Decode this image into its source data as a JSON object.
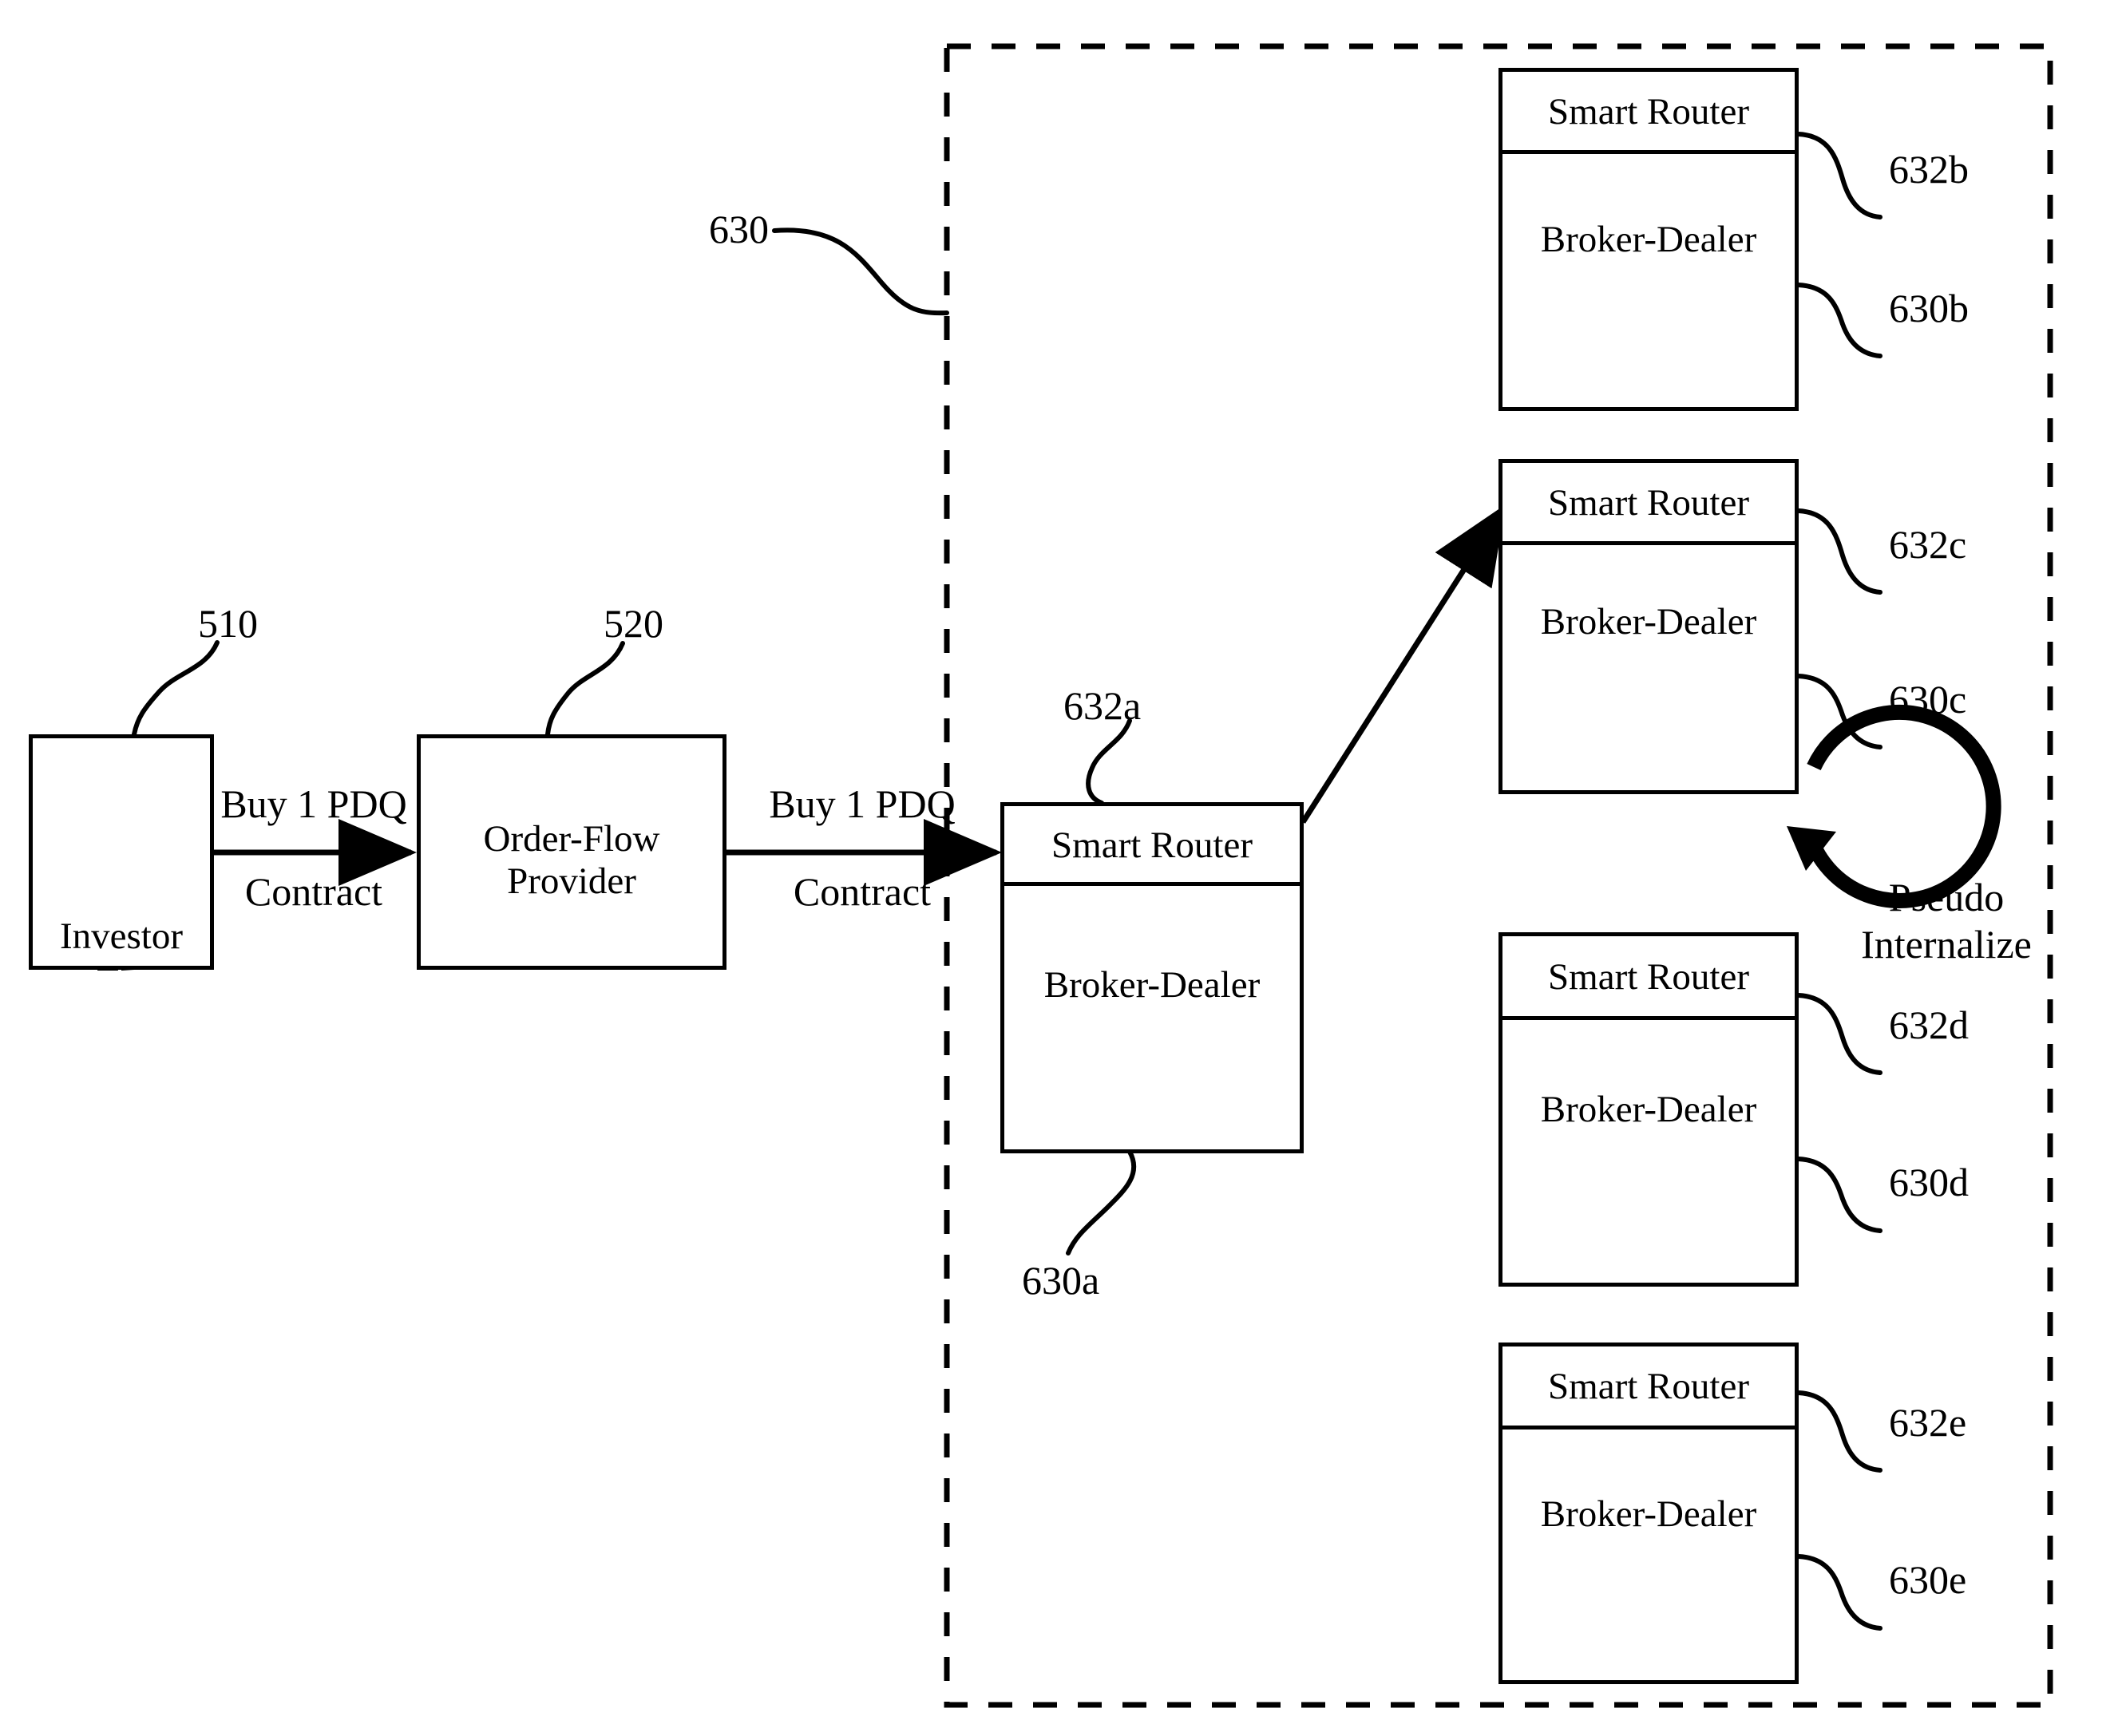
{
  "figure": {
    "type": "patent-flow-diagram",
    "dashed_group_label": "630"
  },
  "entities": {
    "investor": {
      "label": "Investor",
      "ref": "510",
      "icon": "investor-silhouette-icon"
    },
    "order_flow_provider": {
      "label_line1": "Order-Flow",
      "label_line2": "Provider",
      "ref": "520"
    }
  },
  "flows": [
    {
      "id": "investor-to-ofp",
      "label_above": "Buy 1 PDQ",
      "label_below": "Contract"
    },
    {
      "id": "ofp-to-bd-a",
      "label_above": "Buy 1 PDQ",
      "label_below": "Contract"
    }
  ],
  "broker_dealers": [
    {
      "id": "a",
      "router_label": "Smart Router",
      "dealer_label": "Broker-Dealer",
      "router_ref": "632a",
      "dealer_ref": "630a"
    },
    {
      "id": "b",
      "router_label": "Smart Router",
      "dealer_label": "Broker-Dealer",
      "router_ref": "632b",
      "dealer_ref": "630b"
    },
    {
      "id": "c",
      "router_label": "Smart Router",
      "dealer_label": "Broker-Dealer",
      "router_ref": "632c",
      "dealer_ref": "630c"
    },
    {
      "id": "d",
      "router_label": "Smart Router",
      "dealer_label": "Broker-Dealer",
      "router_ref": "632d",
      "dealer_ref": "630d"
    },
    {
      "id": "e",
      "router_label": "Smart Router",
      "dealer_label": "Broker-Dealer",
      "router_ref": "632e",
      "dealer_ref": "630e"
    }
  ],
  "annotations": {
    "pseudo_internalize_line1": "Pseudo",
    "pseudo_internalize_line2": "Internalize"
  },
  "colors": {
    "ink": "#000000",
    "paper": "#ffffff"
  }
}
